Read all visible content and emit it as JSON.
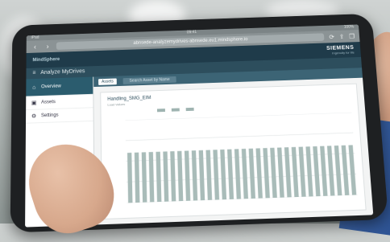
{
  "browser": {
    "status_left": "iPad",
    "status_center": "09:41",
    "status_right": "100%",
    "url": "abnsede-analyzemydrives-abnsede.eu1.mindsphere.io",
    "nav_back": "‹",
    "nav_forward": "›",
    "reload": "⟳",
    "share": "⇪",
    "tabs": "❐"
  },
  "app": {
    "logo_text": "MindSphere",
    "brand": "SIEMENS",
    "brand_sub": "Ingenuity for life",
    "title": "Analyze MyDrives",
    "menu_glyph": "≡"
  },
  "sidebar": {
    "items": [
      {
        "label": "Overview",
        "icon": "home-icon",
        "glyph": "⌂"
      },
      {
        "label": "Assets",
        "icon": "asset-icon",
        "glyph": "▣"
      },
      {
        "label": "Settings",
        "icon": "gear-icon",
        "glyph": "⚙"
      }
    ]
  },
  "tabs": {
    "active": "Assets",
    "search_placeholder": "Search Asset by Name"
  },
  "card": {
    "title": "Handling_SMG_EIM",
    "subtitle": "Load Values"
  },
  "colors": {
    "header": "#1f3b4a",
    "bar": "#a9bcb9"
  },
  "chart_data": {
    "type": "bar",
    "series": [
      {
        "values": [
          0.6,
          0.6,
          0.6,
          0.6,
          0.6,
          0.6,
          0.6,
          0.6,
          0.6,
          0.6,
          0.6,
          0.6,
          0.6,
          0.6,
          0.6,
          0.6,
          0.6,
          0.6,
          0.6,
          0.6,
          0.6,
          0.6,
          0.6,
          0.6,
          0.6,
          0.6,
          0.6,
          0.6,
          0.6,
          0.6,
          0.6,
          0.6
        ]
      }
    ],
    "ylim": [
      0,
      1
    ],
    "grid": true
  }
}
